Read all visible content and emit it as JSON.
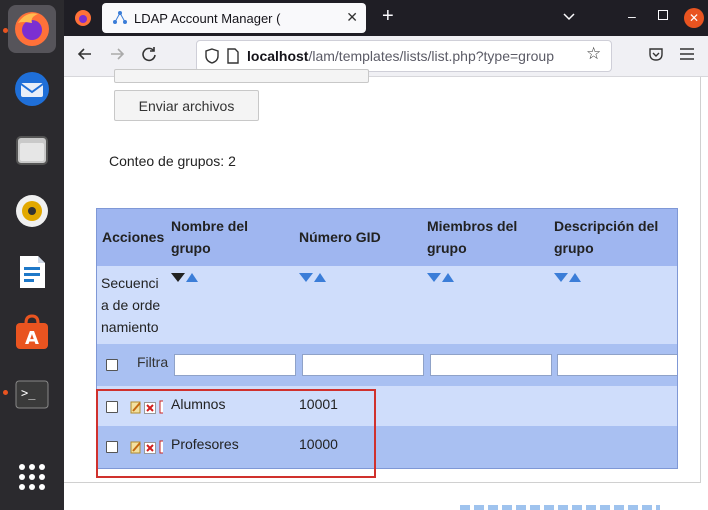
{
  "browser": {
    "tab_title": "LDAP Account Manager (",
    "url_host": "localhost",
    "url_path": "/lam/templates/lists/list.php?type=group"
  },
  "page": {
    "upload_button": "Enviar archivos",
    "group_count": "Conteo de grupos: 2"
  },
  "table": {
    "headers": {
      "actions": "Acciones",
      "name": "Nombre del grupo",
      "gid": "Número GID",
      "members": "Miembros del grupo",
      "description": "Descripción del grupo"
    },
    "sort_label": "Secuencia de ordenamiento",
    "filter_label": "Filtrar",
    "rows": [
      {
        "name": "Alumnos",
        "gid": "10001"
      },
      {
        "name": "Profesores",
        "gid": "10000"
      }
    ]
  },
  "colors": {
    "header_bg": "#9fb6f0",
    "row_light": "#cfddfb",
    "row_dark": "#a9c0f2",
    "highlight_border": "#d0312d",
    "dock_bg": "#2b2a2e"
  }
}
